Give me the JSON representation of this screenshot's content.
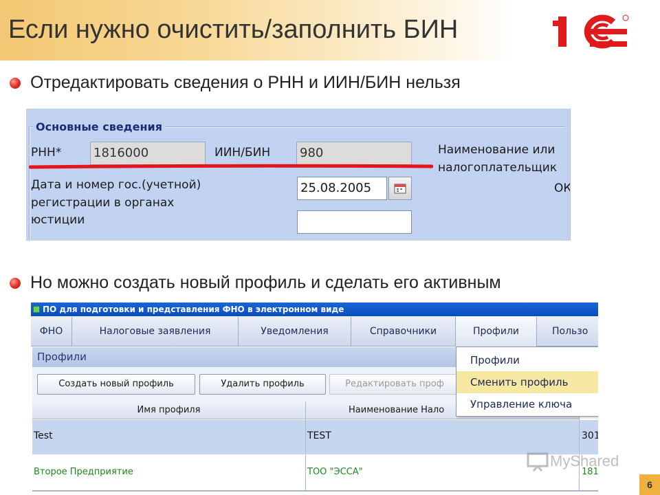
{
  "slide": {
    "title": "Если нужно очистить/заполнить БИН",
    "logo_text": "1С",
    "bullets": [
      "Отредактировать сведения о РНН и ИИН/БИН нельзя",
      "Но можно создать новый профиль и сделать его активным"
    ],
    "page_number": "6",
    "watermark": "MyShared",
    "colors": {
      "accent_orange": "#f0b040",
      "logo_red": "#e01b1b",
      "bullet_red": "#e0332a"
    }
  },
  "screenshot1": {
    "legend": "Основные сведения",
    "rnn_label": "РНН*",
    "rnn_value": "1816000",
    "iin_label": "ИИН/БИН",
    "iin_value": "980",
    "name_label_line1": "Наименование или",
    "name_label_line2": "налогоплательщик",
    "date_label_line1": "Дата и номер гос.(учетной)",
    "date_label_line2": "регистрации в органах",
    "date_label_line3": "юстиции",
    "date_value": "25.08.2005",
    "number_value": "",
    "ok_label": "ОК",
    "calendar_icon": "calendar-icon"
  },
  "screenshot2": {
    "window_title": "ПО для подготовки и представления ФНО в электронном виде",
    "menu": [
      "ФНО",
      "Налоговые заявления",
      "Уведомления",
      "Справочники",
      "Профили",
      "Пользо"
    ],
    "panel_title": "Профили",
    "buttons": {
      "create": "Создать новый профиль",
      "delete": "Удалить профиль",
      "edit": "Редактировать проф"
    },
    "dropdown": [
      "Профили",
      "Сменить профиль",
      "Управление ключа"
    ],
    "columns": [
      "Имя профиля",
      "Наименование Нало"
    ],
    "rows": [
      {
        "name": "Test",
        "org": "TEST",
        "extra": "301"
      },
      {
        "name": "Второе Предприятие",
        "org": "ТОО \"ЭССА\"",
        "extra": "181"
      }
    ]
  }
}
